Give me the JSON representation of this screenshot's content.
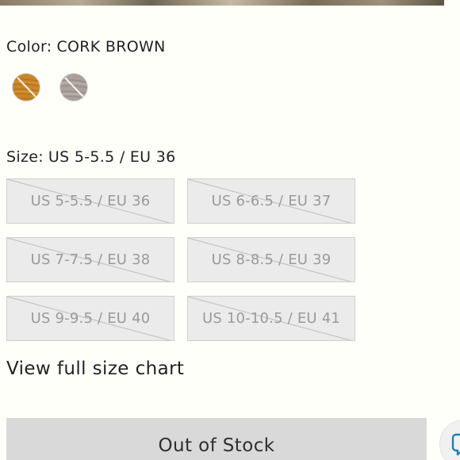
{
  "color_option": {
    "label": "Color:",
    "selected_value": "CORK BROWN",
    "swatches": [
      {
        "name": "cork-brown",
        "color": "#c9862a",
        "available": false
      },
      {
        "name": "taupe-gray",
        "color": "#a9a09a",
        "available": false
      }
    ]
  },
  "size_option": {
    "label": "Size:",
    "selected_value": "US 5-5.5 / EU 36",
    "sizes": [
      {
        "label": "US 5-5.5 / EU 36",
        "available": false
      },
      {
        "label": "US 6-6.5 / EU 37",
        "available": false
      },
      {
        "label": "US 7-7.5 / EU 38",
        "available": false
      },
      {
        "label": "US 8-8.5 / EU 39",
        "available": false
      },
      {
        "label": "US 9-9.5 / EU 40",
        "available": false
      },
      {
        "label": "US 10-10.5 / EU 41",
        "available": false
      }
    ]
  },
  "size_chart_link": "View full size chart",
  "add_to_cart": {
    "label": "Out of Stock",
    "disabled": true
  },
  "colors": {
    "background": "#fffffa",
    "text": "#222222",
    "size_button_bg": "#ebebeb",
    "size_button_border": "#cfcfcf",
    "size_button_text": "#9a9a9a",
    "cart_button_bg": "#d9d9d9",
    "chat_accent": "#1a7fb8"
  },
  "icons": {
    "chat": "chat-bubble-icon"
  }
}
